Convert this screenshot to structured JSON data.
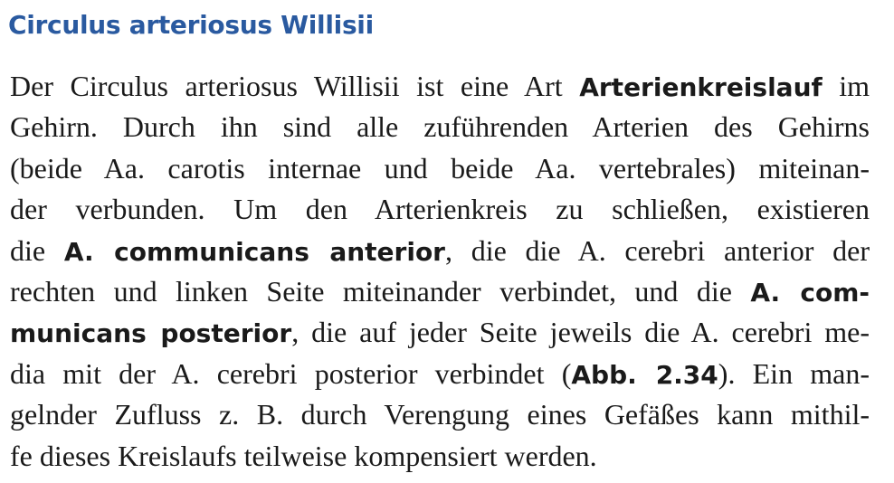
{
  "heading": "Circulus arteriosus Willisii",
  "lines": [
    [
      "Der Circulus arteriosus Willisii ist eine Art ",
      "Arterienkreislauf",
      " im"
    ],
    [
      "Gehirn. Durch ihn sind alle zuführenden Arterien des Gehirns"
    ],
    [
      "(beide Aa. carotis internae und beide Aa. vertebrales) miteinan-"
    ],
    [
      "der verbunden. Um den Arterienkreis zu schließen, existieren"
    ],
    [
      "die ",
      "A. communicans anterior",
      ", die die A. cerebri anterior der"
    ],
    [
      "rechten und linken Seite miteinander verbindet, und die ",
      "A. com-"
    ],
    [
      "municans posterior",
      ", die auf jeder Seite jeweils die A. cerebri me-"
    ],
    [
      "dia mit der A. cerebri posterior verbindet (",
      "Abb. 2.34",
      "). Ein man-"
    ],
    [
      "gelnder Zufluss z. B. durch Verengung eines Gefäßes kann mithil-"
    ],
    [
      "fe dieses Kreislaufs teilweise kompensiert werden."
    ]
  ]
}
